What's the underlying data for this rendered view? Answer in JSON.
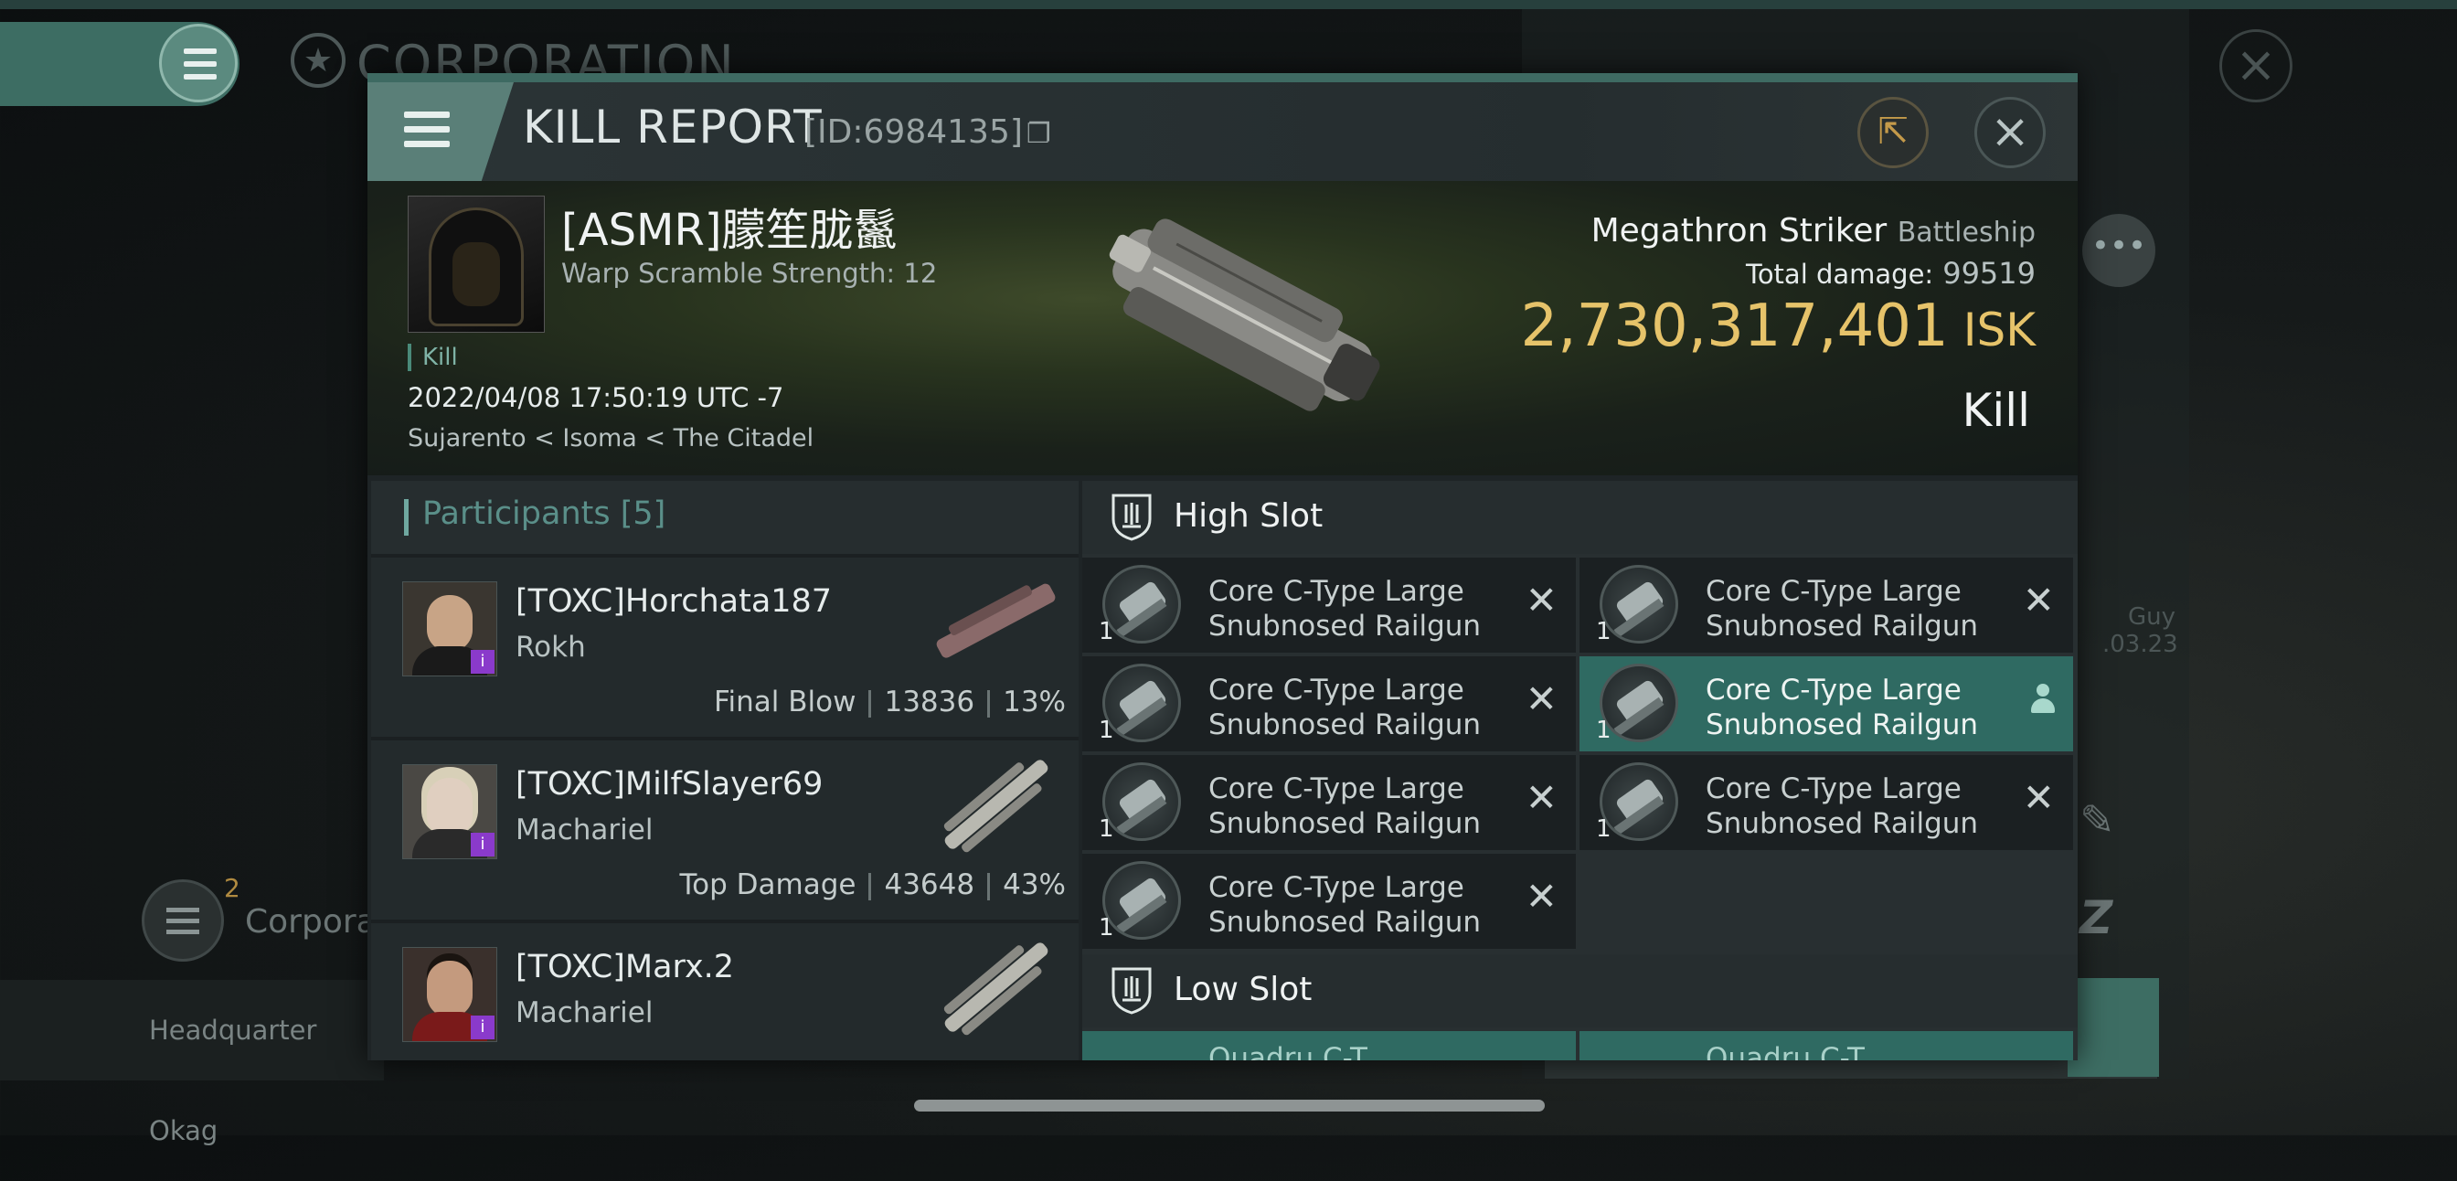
{
  "background": {
    "corp_title": "CORPORATION",
    "corp_short": "Corpora",
    "corp_badge": "2",
    "hq_text": "Headquarter Okag",
    "side_name": "Guy",
    "side_date": ".03.23"
  },
  "report": {
    "title": "KILL REPORT",
    "id_label": "[ID:6984135]",
    "victim": {
      "name": "[ASMR]朦笙胧鬣",
      "warp_strength": "Warp Scramble Strength: 12",
      "kill_tag": "Kill",
      "timestamp": "2022/04/08 17:50:19 UTC -7",
      "location": "Sujarento < Isoma < The Citadel"
    },
    "ship": {
      "name": "Megathron Striker",
      "class": "Battleship",
      "total_damage_label": "Total damage:",
      "total_damage": "99519",
      "isk_value": "2,730,317,401",
      "isk_unit": "ISK",
      "result": "Kill"
    }
  },
  "participants": {
    "header": "Participants [5]",
    "rows": [
      {
        "name": "[TOXC]Horchata187",
        "ship": "Rokh",
        "role": "Final Blow",
        "damage": "13836",
        "percent": "13%"
      },
      {
        "name": "[TOXC]MilfSlayer69",
        "ship": "Machariel",
        "role": "Top Damage",
        "damage": "43648",
        "percent": "43%"
      },
      {
        "name": "[TOXC]Marx.2",
        "ship": "Machariel",
        "role": "",
        "damage": "",
        "percent": ""
      }
    ]
  },
  "slots": {
    "high_label": "High Slot",
    "low_label": "Low Slot",
    "high_modules": [
      {
        "qty": "1",
        "line1": "Core C-Type Large",
        "line2": "Snubnosed Railgun",
        "state": "destroyed"
      },
      {
        "qty": "1",
        "line1": "Core C-Type Large",
        "line2": "Snubnosed Railgun",
        "state": "destroyed"
      },
      {
        "qty": "1",
        "line1": "Core C-Type Large",
        "line2": "Snubnosed Railgun",
        "state": "destroyed"
      },
      {
        "qty": "1",
        "line1": "Core C-Type Large",
        "line2": "Snubnosed Railgun",
        "state": "dropped"
      },
      {
        "qty": "1",
        "line1": "Core C-Type Large",
        "line2": "Snubnosed Railgun",
        "state": "destroyed"
      },
      {
        "qty": "1",
        "line1": "Core C-Type Large",
        "line2": "Snubnosed Railgun",
        "state": "destroyed"
      },
      {
        "qty": "1",
        "line1": "Core C-Type Large",
        "line2": "Snubnosed Railgun",
        "state": "destroyed"
      }
    ],
    "low_modules_partial": [
      "Quadru C-T",
      "Quadru C-T"
    ]
  },
  "icons": {
    "menu": "hamburger-icon",
    "copy": "copy-icon",
    "share": "share-icon",
    "close": "close-icon",
    "destroyed": "x-icon",
    "dropped": "person-icon",
    "slot": "shield-icon"
  },
  "colors": {
    "isk": "#e6c36a",
    "accent": "#3e6a62",
    "selected": "#2f6a62"
  }
}
